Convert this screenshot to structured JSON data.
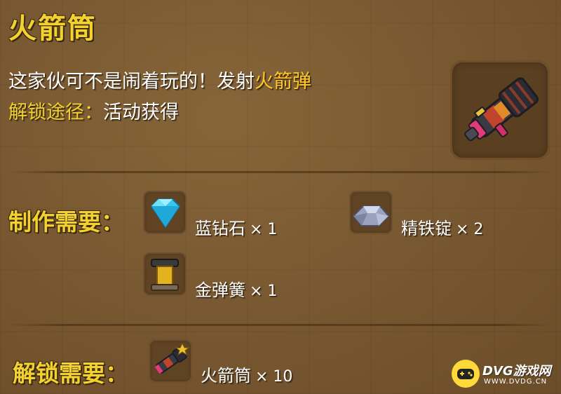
{
  "item": {
    "name": "火箭筒",
    "icon": "rocket-launcher-icon"
  },
  "description": {
    "text": "这家伙可不是闹着玩的！发射",
    "highlight": "火箭弹"
  },
  "unlock_method": {
    "label": "解锁途径：",
    "value": "活动获得"
  },
  "crafting": {
    "label": "制作需要：",
    "materials": [
      {
        "name": "蓝钻石",
        "qty": "× 1",
        "icon": "blue-diamond-icon"
      },
      {
        "name": "精铁锭",
        "qty": "× 2",
        "icon": "iron-ingot-icon"
      },
      {
        "name": "金弹簧",
        "qty": "× 1",
        "icon": "gold-spring-icon"
      }
    ]
  },
  "unlock_requirement": {
    "label": "解锁需要：",
    "materials": [
      {
        "name": "火箭筒",
        "qty": "× 10",
        "icon": "rocket-launcher-fragment-icon"
      }
    ]
  },
  "watermark": {
    "brand": "DVG游戏网",
    "url": "WWW.DVDG.CN",
    "icon": "gamepad-logo-icon"
  },
  "colors": {
    "title": "#f3d22f",
    "highlight": "#ffc828",
    "panel": "#775730"
  }
}
